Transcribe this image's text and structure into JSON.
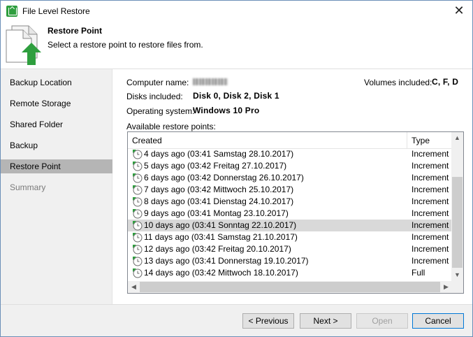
{
  "window": {
    "title": "File Level Restore"
  },
  "header": {
    "title": "Restore Point",
    "subtitle": "Select a restore point to restore files from."
  },
  "nav": [
    {
      "label": "Backup Location",
      "state": "normal"
    },
    {
      "label": "Remote Storage",
      "state": "normal"
    },
    {
      "label": "Shared Folder",
      "state": "normal"
    },
    {
      "label": "Backup",
      "state": "normal"
    },
    {
      "label": "Restore Point",
      "state": "active"
    },
    {
      "label": "Summary",
      "state": "disabled"
    }
  ],
  "info": {
    "computer_name_label": "Computer name:",
    "volumes_label": "Volumes included:",
    "volumes_value": "C, F, D",
    "disks_label": "Disks included:",
    "disks_value": "Disk 0, Disk 2, Disk 1",
    "os_label": "Operating system:",
    "os_value": "Windows 10 Pro",
    "available_label": "Available restore points:"
  },
  "table": {
    "col_created": "Created",
    "col_type": "Type",
    "rows": [
      {
        "created": "4 days ago (03:41 Samstag 28.10.2017)",
        "type": "Increment"
      },
      {
        "created": "5 days ago (03:42 Freitag 27.10.2017)",
        "type": "Increment"
      },
      {
        "created": "6 days ago (03:42 Donnerstag 26.10.2017)",
        "type": "Increment"
      },
      {
        "created": "7 days ago (03:42 Mittwoch 25.10.2017)",
        "type": "Increment"
      },
      {
        "created": "8 days ago (03:41 Dienstag 24.10.2017)",
        "type": "Increment"
      },
      {
        "created": "9 days ago (03:41 Montag 23.10.2017)",
        "type": "Increment"
      },
      {
        "created": "10 days ago (03:41 Sonntag 22.10.2017)",
        "type": "Increment",
        "selected": true
      },
      {
        "created": "11 days ago (03:41 Samstag 21.10.2017)",
        "type": "Increment"
      },
      {
        "created": "12 days ago (03:42 Freitag 20.10.2017)",
        "type": "Increment"
      },
      {
        "created": "13 days ago (03:41 Donnerstag 19.10.2017)",
        "type": "Increment"
      },
      {
        "created": "14 days ago (03:42 Mittwoch 18.10.2017)",
        "type": "Full"
      }
    ]
  },
  "buttons": {
    "previous": "< Previous",
    "next": "Next >",
    "open": "Open",
    "cancel": "Cancel"
  },
  "colors": {
    "accent": "#0078d7",
    "selected_row": "#d9d9d9",
    "nav_active": "#b5b5b5",
    "icon_green": "#2e9e3e"
  }
}
